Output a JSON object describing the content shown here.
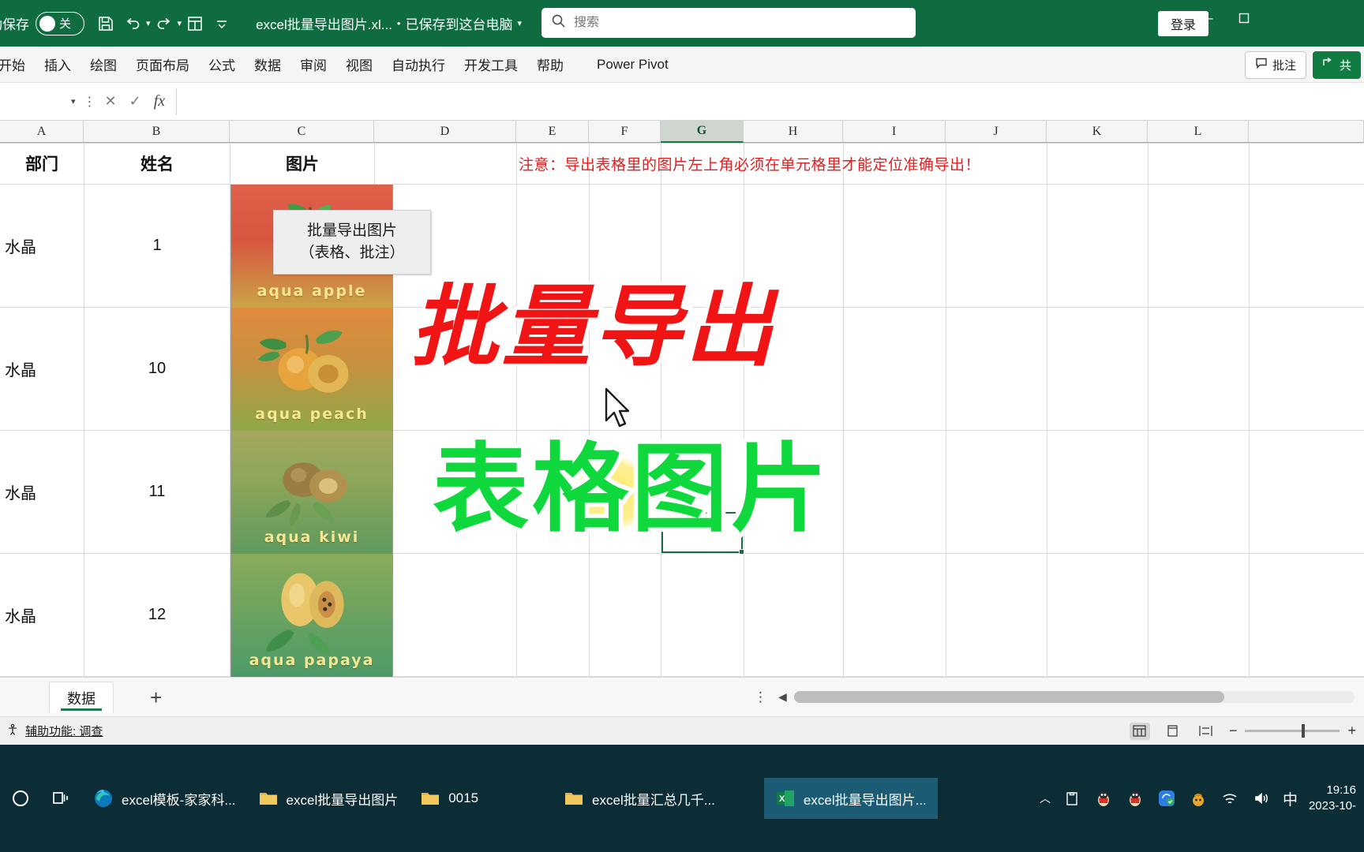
{
  "titlebar": {
    "autosave_label": "动保存",
    "autosave_state": "关",
    "doc_name": "excel批量导出图片.xl...",
    "doc_separator": "•",
    "doc_saved_status": "已保存到这台电脑",
    "signin_label": "登录",
    "minimize_label": "—",
    "maximize_label": "▫"
  },
  "search": {
    "placeholder": "搜索",
    "value": ""
  },
  "ribbon": {
    "tabs": [
      {
        "label": "开始"
      },
      {
        "label": "插入"
      },
      {
        "label": "绘图"
      },
      {
        "label": "页面布局"
      },
      {
        "label": "公式"
      },
      {
        "label": "数据"
      },
      {
        "label": "审阅"
      },
      {
        "label": "视图"
      },
      {
        "label": "自动执行"
      },
      {
        "label": "开发工具"
      },
      {
        "label": "帮助"
      },
      {
        "label": "Power Pivot"
      }
    ],
    "comment_button": "批注",
    "share_button": "共"
  },
  "formulabar": {
    "namebox_value": "",
    "value": ""
  },
  "grid": {
    "columns": [
      "A",
      "B",
      "C",
      "D",
      "E",
      "F",
      "G",
      "H",
      "I",
      "J",
      "K",
      "L"
    ],
    "selected_column": "G",
    "headers": {
      "a": "部门",
      "b": "姓名",
      "c": "图片"
    },
    "warning_text": "注意：导出表格里的图片左上角必须在单元格里才能定位准确导出！",
    "warning_color": "#e02020",
    "rows": [
      {
        "dept": "水晶",
        "name": "1",
        "fruit_word": "aqua apple",
        "c1": "#d6503c",
        "c2": "#c8b060"
      },
      {
        "dept": "水晶",
        "name": "10",
        "fruit_word": "aqua peach",
        "c1": "#d98a3c",
        "c2": "#8fa84a"
      },
      {
        "dept": "水晶",
        "name": "11",
        "fruit_word": "aqua kiwi",
        "c1": "#9aa35a",
        "c2": "#6f9a5a"
      },
      {
        "dept": "水晶",
        "name": "12",
        "fruit_word": "aqua papaya",
        "c1": "#7fa85c",
        "c2": "#4d9a66"
      }
    ]
  },
  "macro_button": {
    "line1": "批量导出图片",
    "line2": "（表格、批注）"
  },
  "overlay": {
    "headline_red": "批量导出",
    "headline_green": "表格图片",
    "red_color": "#f01414",
    "green_color": "#0fd83c"
  },
  "sheetbar": {
    "tabs": [
      {
        "label": "数据",
        "active": true
      }
    ],
    "add_label": "+",
    "more_label": "⋮",
    "scroll_left": "◀"
  },
  "statusbar": {
    "accessibility": "辅助功能: 调查",
    "views": [
      "normal-view",
      "page-layout-view",
      "page-break-view"
    ],
    "zoom_minus": "−",
    "zoom_plus": "+"
  },
  "taskbar": {
    "tasks": [
      {
        "label": "excel模板-家家科...",
        "icon": "edge-icon",
        "active": false
      },
      {
        "label": "excel批量导出图片",
        "icon": "folder-icon",
        "active": false
      },
      {
        "label": "0015",
        "icon": "folder-icon",
        "active": false
      },
      {
        "label": "excel批量汇总几千...",
        "icon": "folder-icon",
        "active": false
      },
      {
        "label": "excel批量导出图片...",
        "icon": "excel-icon",
        "active": true
      }
    ],
    "ime": "中",
    "clock_time": "19:16",
    "clock_date": "2023-10-"
  }
}
